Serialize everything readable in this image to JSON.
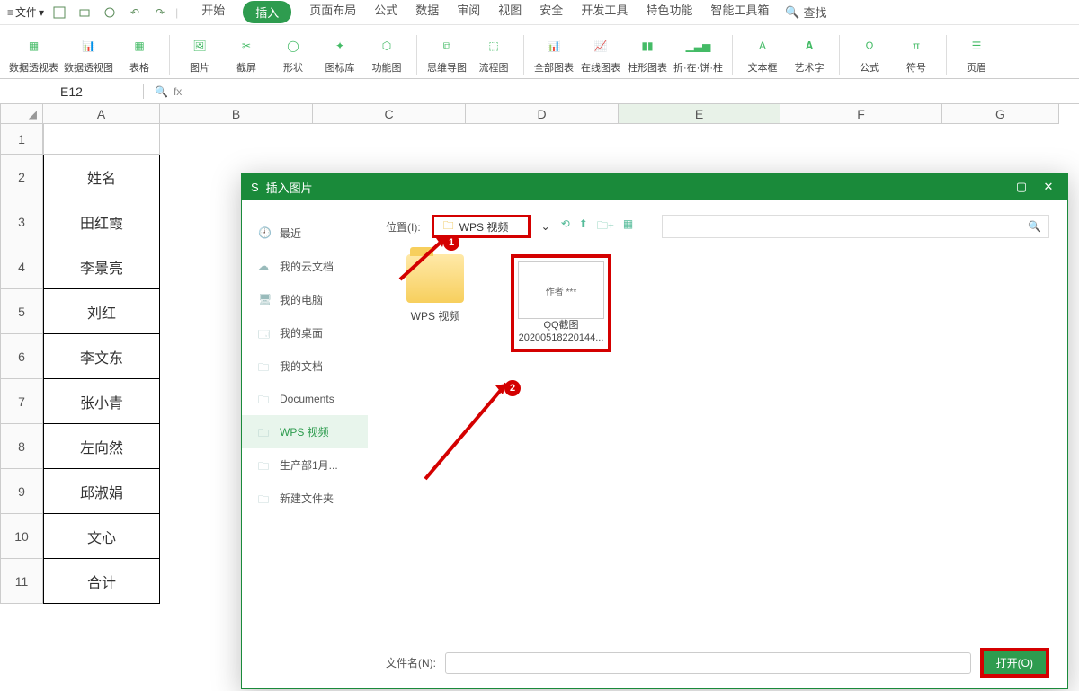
{
  "menubar": {
    "file_label": "文件",
    "tabs": [
      "开始",
      "插入",
      "页面布局",
      "公式",
      "数据",
      "审阅",
      "视图",
      "安全",
      "开发工具",
      "特色功能",
      "智能工具箱"
    ],
    "active_tab_index": 1,
    "search_label": "查找"
  },
  "ribbon": [
    "数据透视表",
    "数据透视图",
    "表格",
    "图片",
    "截屏",
    "形状",
    "图标库",
    "功能图",
    "思维导图",
    "流程图",
    "全部图表",
    "在线图表",
    "柱形图表",
    "折·在·饼·柱",
    "文本框",
    "艺术字",
    "公式",
    "符号",
    "页眉"
  ],
  "formula": {
    "cell_ref": "E12",
    "fx": "fx"
  },
  "columns": [
    "A",
    "B",
    "C",
    "D",
    "E",
    "F",
    "G"
  ],
  "rows": {
    "labels": [
      "1",
      "2",
      "3",
      "4",
      "5",
      "6",
      "7",
      "8",
      "9",
      "10",
      "11"
    ],
    "colA": [
      "",
      "姓名",
      "田红霞",
      "李景亮",
      "刘红",
      "李文东",
      "张小青",
      "左向然",
      "邱淑娟",
      "文心",
      "合计"
    ]
  },
  "dialog": {
    "title": "插入图片",
    "sidebar": [
      {
        "icon": "clock-icon",
        "label": "最近"
      },
      {
        "icon": "cloud-icon",
        "label": "我的云文档"
      },
      {
        "icon": "monitor-icon",
        "label": "我的电脑"
      },
      {
        "icon": "desktop-icon",
        "label": "我的桌面"
      },
      {
        "icon": "folder-icon",
        "label": "我的文档"
      },
      {
        "icon": "folder-icon",
        "label": "Documents"
      },
      {
        "icon": "folder-icon",
        "label": "WPS 视频"
      },
      {
        "icon": "folder-icon",
        "label": "生产部1月..."
      },
      {
        "icon": "folder-icon",
        "label": "新建文件夹"
      }
    ],
    "sidebar_active_index": 6,
    "location_label": "位置(I):",
    "location_value": "WPS 视频",
    "files": {
      "folder": {
        "name": "WPS 视频"
      },
      "image": {
        "thumb_text": "作者 ***",
        "name_line1": "QQ截图",
        "name_line2": "20200518220144..."
      }
    },
    "badges": {
      "one": "1",
      "two": "2"
    },
    "filename_label": "文件名(N):",
    "open_button": "打开(O)"
  }
}
